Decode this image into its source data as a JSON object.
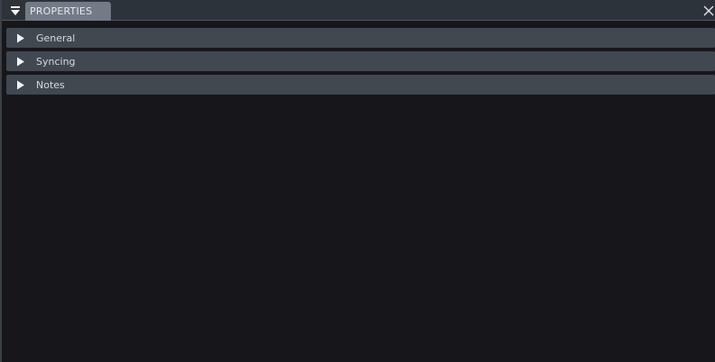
{
  "panel": {
    "tab_label": "PROPERTIES",
    "menu_icon": "menu-triangle-icon",
    "close_icon": "close-icon"
  },
  "sections": [
    {
      "label": "General",
      "expanded": false,
      "icon": "expand-arrow-icon"
    },
    {
      "label": "Syncing",
      "expanded": false,
      "icon": "expand-arrow-icon"
    },
    {
      "label": "Notes",
      "expanded": false,
      "icon": "expand-arrow-icon"
    }
  ],
  "colors": {
    "background": "#17171b",
    "header": "#2d333a",
    "tab": "#727b86",
    "section": "#404850",
    "text": "#d6dade"
  }
}
